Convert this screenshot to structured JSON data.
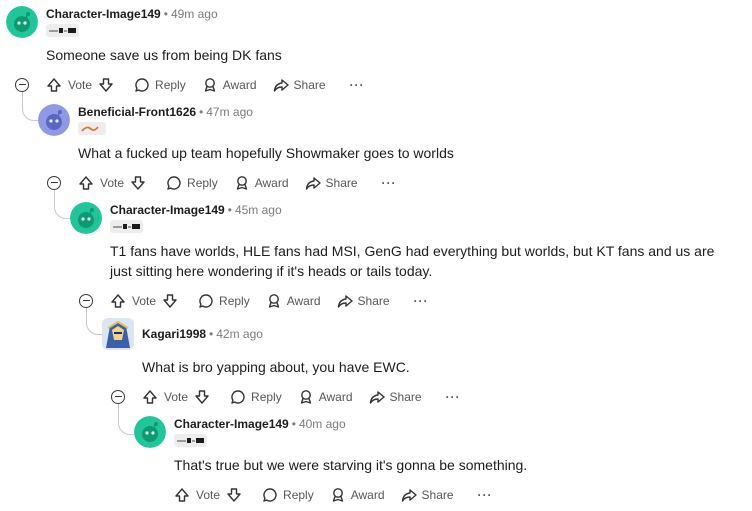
{
  "comments": [
    {
      "author": "Character-Image149",
      "sep": "•",
      "time": "49m ago",
      "text": "Someone save us from being DK fans",
      "avatar_color": "#21c59a"
    },
    {
      "author": "Beneficial-Front1626",
      "sep": "•",
      "time": "47m ago",
      "text": "What a fucked up team hopefully Showmaker goes to worlds",
      "avatar_color": "#8f99e6"
    },
    {
      "author": "Character-Image149",
      "sep": "•",
      "time": "45m ago",
      "text": "T1 fans have worlds, HLE fans had MSI, GenG had everything but worlds, but KT fans and us are just sitting here wondering if it's heads or tails today.",
      "avatar_color": "#21c59a"
    },
    {
      "author": "Kagari1998",
      "sep": "•",
      "time": "42m ago",
      "text": "What is bro yapping about, you have EWC.",
      "avatar_color": "#3b5fa8"
    },
    {
      "author": "Character-Image149",
      "sep": "•",
      "time": "40m ago",
      "text": "That's true but we were starving it's gonna be something.",
      "avatar_color": "#21c59a"
    }
  ],
  "actions": {
    "vote": "Vote",
    "reply": "Reply",
    "award": "Award",
    "share": "Share",
    "more": "···"
  },
  "icons": {
    "upvote": "arrow-up-icon",
    "downvote": "arrow-down-icon",
    "reply": "speech-bubble-icon",
    "award": "award-icon",
    "share": "share-arrow-icon",
    "more": "ellipsis-icon",
    "collapse": "collapse-minus-icon"
  }
}
